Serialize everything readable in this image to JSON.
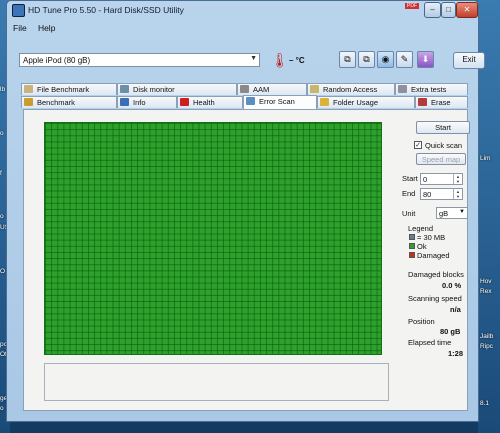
{
  "desktop": {
    "left_labels": [
      "lb",
      "o",
      "f",
      "o",
      "US",
      "O",
      "pc",
      "Off",
      "ge",
      "o"
    ],
    "right_labels": [
      "Lim",
      "Hov",
      "Rex",
      "Jailb",
      "Ripc",
      "8.1"
    ],
    "top_badges": [
      "PDF",
      "3"
    ]
  },
  "window": {
    "title": "HD Tune Pro 5.50 - Hard Disk/SSD Utility",
    "min_label": "–",
    "max_label": "□",
    "close_label": "✕"
  },
  "menu": {
    "file": "File",
    "help": "Help"
  },
  "toolbar": {
    "drive": "Apple   iPod (80 gB)",
    "temperature": "– °C",
    "exit": "Exit"
  },
  "tabs_top": [
    {
      "label": "File Benchmark",
      "color": "#c9b37a"
    },
    {
      "label": "Disk monitor",
      "color": "#6f8ea8"
    },
    {
      "label": "AAM",
      "color": "#8a8a8a"
    },
    {
      "label": "Random Access",
      "color": "#c7b76a"
    },
    {
      "label": "Extra tests",
      "color": "#8f8fa0"
    }
  ],
  "tabs_bottom": [
    {
      "label": "Benchmark",
      "color": "#c99e2f"
    },
    {
      "label": "Info",
      "color": "#3b6fb8"
    },
    {
      "label": "Health",
      "color": "#cc1f1f"
    },
    {
      "label": "Error Scan",
      "color": "#5b8ec2"
    },
    {
      "label": "Folder Usage",
      "color": "#d9b43a"
    },
    {
      "label": "Erase",
      "color": "#b43b3b"
    }
  ],
  "error_scan": {
    "start_button": "Start",
    "quick_scan_label": "Quick scan",
    "quick_scan_checked": true,
    "speed_map_button": "Speed map",
    "start_label": "Start",
    "start_value": "0",
    "end_label": "End",
    "end_value": "80",
    "unit_label": "Unit",
    "unit_value": "gB",
    "legend_title": "Legend",
    "legend_block": "= 30 MB",
    "legend_ok": "Ok",
    "legend_damaged": "Damaged",
    "damaged_blocks_label": "Damaged blocks",
    "damaged_blocks_value": "0.0 %",
    "scanning_speed_label": "Scanning speed",
    "scanning_speed_value": "n/a",
    "position_label": "Position",
    "position_value": "80 gB",
    "elapsed_label": "Elapsed time",
    "elapsed_value": "1:28",
    "colors": {
      "ok": "#2ca12c",
      "damaged": "#cc2a1a",
      "block": "#6b7c8c"
    }
  }
}
